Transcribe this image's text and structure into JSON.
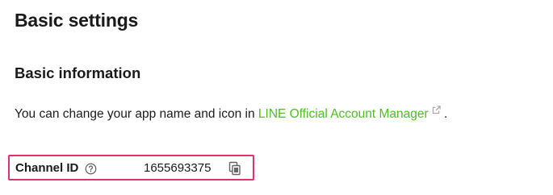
{
  "page": {
    "title": "Basic settings"
  },
  "basic_information": {
    "heading": "Basic information",
    "description_before": "You can change your app name and icon in ",
    "link_text": "LINE Official Account Manager",
    "description_after": " .",
    "link_color": "#4cc11f"
  },
  "channel": {
    "id_label": "Channel ID",
    "id_value": "1655693375",
    "help_icon": "question-circle-icon",
    "copy_icon": "copy-icon",
    "highlight_color": "#e0336a"
  }
}
